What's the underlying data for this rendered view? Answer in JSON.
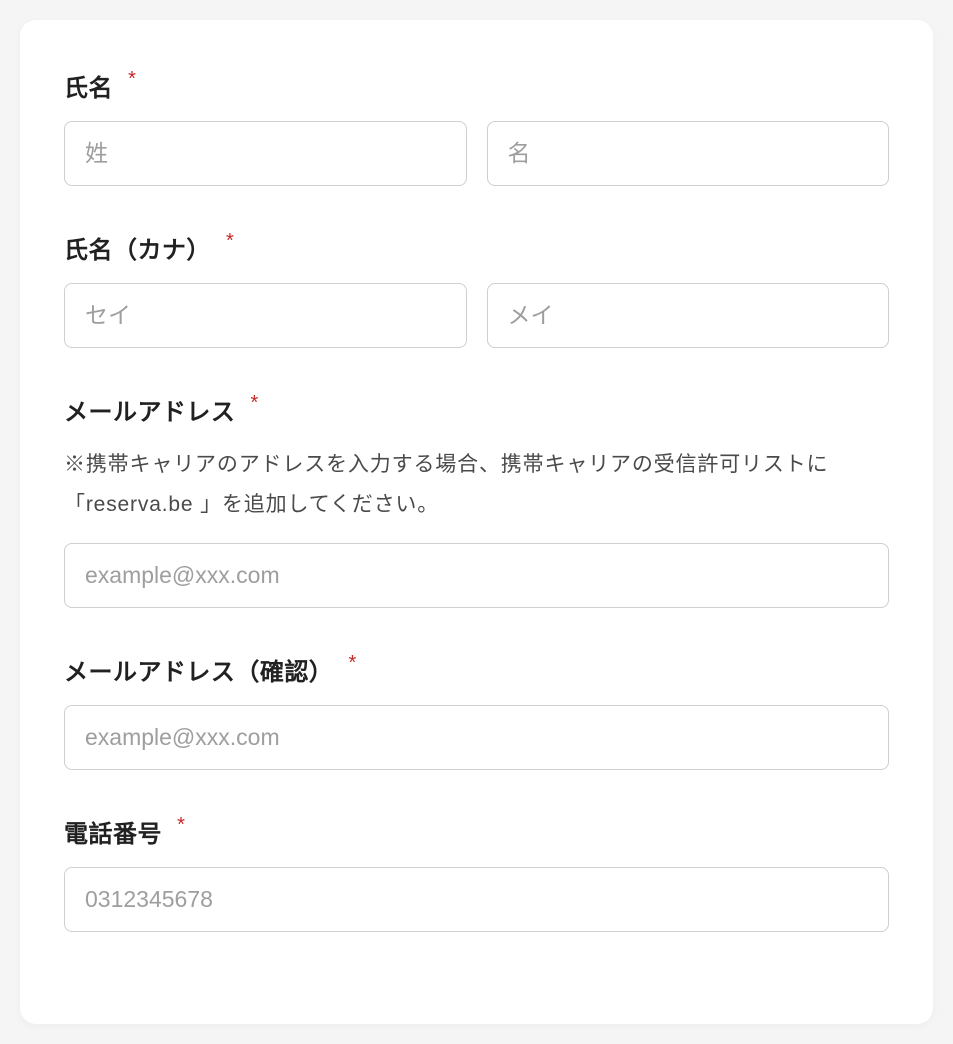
{
  "form": {
    "name": {
      "label": "氏名",
      "required_mark": "*",
      "last_placeholder": "姓",
      "first_placeholder": "名"
    },
    "name_kana": {
      "label": "氏名（カナ）",
      "required_mark": "*",
      "last_placeholder": "セイ",
      "first_placeholder": "メイ"
    },
    "email": {
      "label": "メールアドレス",
      "required_mark": "*",
      "help": "※携帯キャリアのアドレスを入力する場合、携帯キャリアの受信許可リストに「reserva.be 」を追加してください。",
      "placeholder": "example@xxx.com"
    },
    "email_confirm": {
      "label": "メールアドレス（確認）",
      "required_mark": "*",
      "placeholder": "example@xxx.com"
    },
    "phone": {
      "label": "電話番号",
      "required_mark": "*",
      "placeholder": "0312345678"
    }
  }
}
